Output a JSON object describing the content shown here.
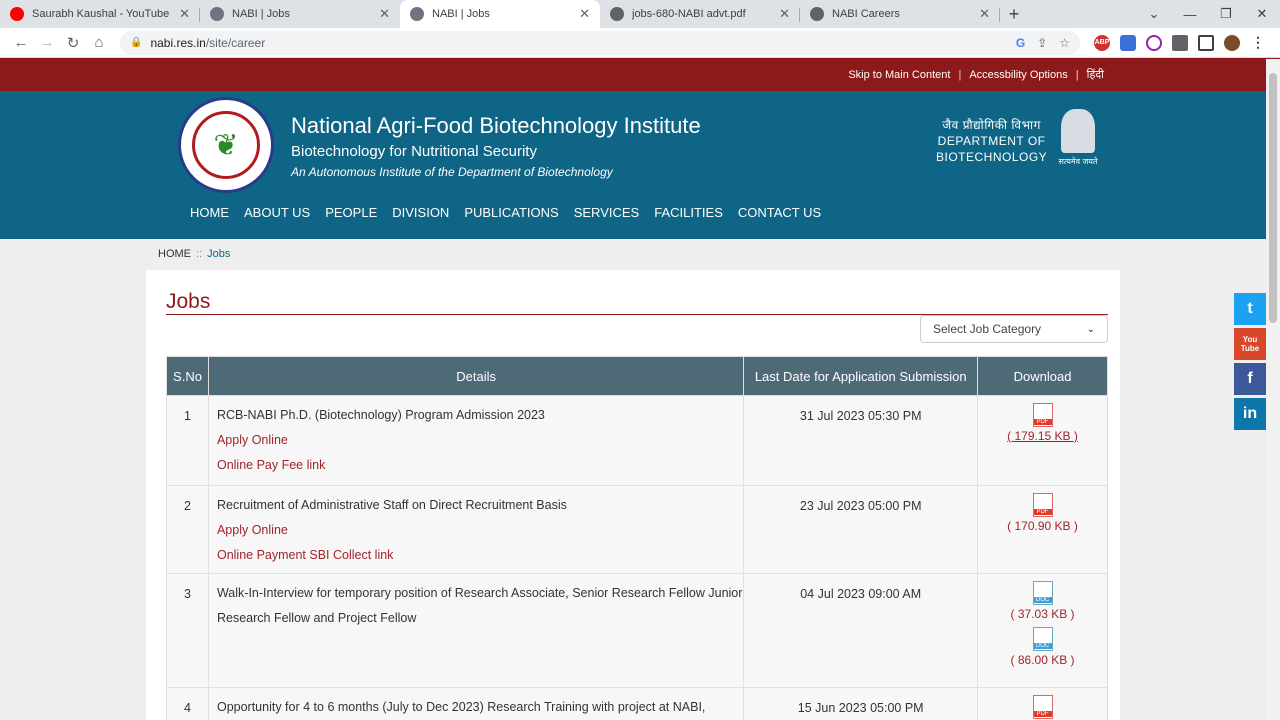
{
  "browser": {
    "tabs": [
      {
        "title": "Saurabh Kaushal - YouTube",
        "favicon": "youtube-icon",
        "color": "#ff0000"
      },
      {
        "title": "NABI | Jobs",
        "favicon": "nabi-icon",
        "color": "#6f7480"
      },
      {
        "title": "NABI | Jobs",
        "favicon": "nabi-icon",
        "color": "#6f7480"
      },
      {
        "title": "jobs-680-NABI advt.pdf",
        "favicon": "globe-icon",
        "color": "#5f6368"
      },
      {
        "title": "NABI Careers",
        "favicon": "globe-icon",
        "color": "#5f6368"
      }
    ],
    "active_tab": 2,
    "url_domain": "nabi.res.in",
    "url_path": "/site/career"
  },
  "topstrip": {
    "skip": "Skip to Main Content",
    "accessibility": "Accessbility Options",
    "hindi": "हिंदी"
  },
  "header": {
    "name": "National Agri-Food Biotechnology Institute",
    "tagline": "Biotechnology for Nutritional Security",
    "subtitle": "An Autonomous Institute of the Department of Biotechnology",
    "dbt_hindi": "जैव प्रौद्योगिकी विभाग",
    "dbt_line1": "DEPARTMENT OF",
    "dbt_line2": "BIOTECHNOLOGY",
    "emblem_motto": "सत्यमेव जयते"
  },
  "menu": [
    "HOME",
    "ABOUT US",
    "PEOPLE",
    "DIVISION",
    "PUBLICATIONS",
    "SERVICES",
    "FACILITIES",
    "CONTACT US"
  ],
  "breadcrumb": {
    "home": "HOME",
    "sep": "::",
    "current": "Jobs"
  },
  "jobs": {
    "title": "Jobs",
    "select_placeholder": "Select Job Category",
    "columns": [
      "S.No",
      "Details",
      "Last Date for Application Submission",
      "Download"
    ],
    "rows": [
      {
        "sno": "1",
        "title": "RCB-NABI Ph.D. (Biotechnology) Program Admission 2023",
        "links": [
          "Apply Online",
          "Online Pay Fee link"
        ],
        "date": "31 Jul 2023 05:30 PM",
        "files": [
          {
            "type": "pdf",
            "size": "( 179.15 KB )"
          }
        ]
      },
      {
        "sno": "2",
        "title": "Recruitment of Administrative Staff on Direct Recruitment Basis",
        "links": [
          "Apply Online",
          "Online Payment SBI Collect link"
        ],
        "date": "23 Jul 2023 05:00 PM",
        "files": [
          {
            "type": "pdf",
            "size": "( 170.90 KB )"
          }
        ]
      },
      {
        "sno": "3",
        "title": "Walk-In-Interview for temporary position of Research Associate, Senior Research Fellow Junior Research Fellow and Project Fellow",
        "links": [],
        "date": "04 Jul 2023 09:00 AM",
        "files": [
          {
            "type": "doc",
            "size": "( 37.03 KB )"
          },
          {
            "type": "doc",
            "size": "( 86.00 KB )"
          }
        ]
      },
      {
        "sno": "4",
        "title": "Opportunity for 4 to 6 months (July to Dec 2023) Research Training with project at NABI,",
        "links": [],
        "date": "15 Jun 2023 05:00 PM",
        "files": [
          {
            "type": "pdf",
            "size": ""
          }
        ]
      }
    ]
  },
  "social": [
    {
      "name": "twitter-icon",
      "glyph": "t",
      "color": "#1da1f2"
    },
    {
      "name": "youtube-icon",
      "glyph": "You Tube",
      "color": "#d9472b"
    },
    {
      "name": "facebook-icon",
      "glyph": "f",
      "color": "#3b5998"
    },
    {
      "name": "linkedin-icon",
      "glyph": "in",
      "color": "#0e76a8"
    }
  ]
}
